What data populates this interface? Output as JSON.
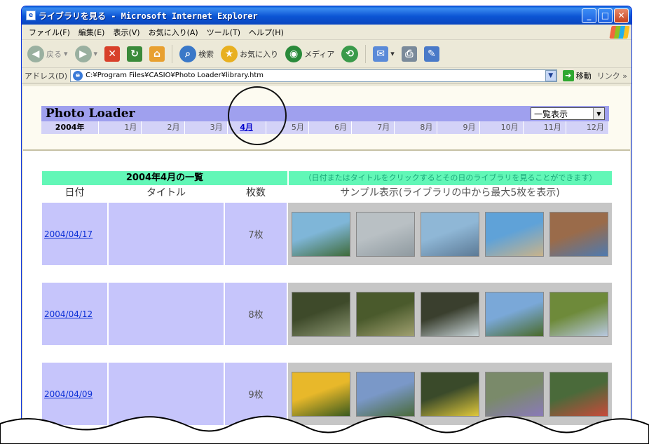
{
  "window": {
    "title": "ライブラリを見る - Microsoft Internet Explorer",
    "app_icon_glyph": "e"
  },
  "menubar": [
    "ファイル(F)",
    "編集(E)",
    "表示(V)",
    "お気に入り(A)",
    "ツール(T)",
    "ヘルプ(H)"
  ],
  "toolbar": {
    "back": "戻る",
    "search": "検索",
    "favorites": "お気に入り",
    "media": "メディア"
  },
  "address": {
    "label": "アドレス(D)",
    "value": "C:¥Program Files¥CASIO¥Photo Loader¥library.htm",
    "go": "移動",
    "links": "リンク »"
  },
  "page": {
    "title": "Photo Loader",
    "view_select": "一覧表示",
    "year": "2004年",
    "months": [
      "1月",
      "2月",
      "3月",
      "4月",
      "5月",
      "6月",
      "7月",
      "8月",
      "9月",
      "10月",
      "11月",
      "12月"
    ],
    "active_month_index": 3,
    "list_title": "2004年4月の一覧",
    "list_hint": "（日付またはタイトルをクリックするとその日のライブラリを見ることができます）",
    "columns": {
      "date": "日付",
      "title": "タイトル",
      "count": "枚数",
      "sample": "サンプル表示(ライブラリの中から最大5枚を表示)"
    },
    "rows": [
      {
        "date": "2004/04/17",
        "count": "7枚",
        "thumbs": [
          [
            "#7fb6d8",
            "#3f6b3a"
          ],
          [
            "#b9c0c4",
            "#8f9aa0"
          ],
          [
            "#8fb7d6",
            "#5c7a96"
          ],
          [
            "#5fa2d8",
            "#c9b38a"
          ],
          [
            "#9a6b4a",
            "#4e7ab0"
          ]
        ]
      },
      {
        "date": "2004/04/12",
        "count": "8枚",
        "thumbs": [
          [
            "#3e4a2a",
            "#8a9470"
          ],
          [
            "#4a5a2c",
            "#a0a070"
          ],
          [
            "#3a3f2e",
            "#c8d4d8"
          ],
          [
            "#7aa8d8",
            "#4a6a2a"
          ],
          [
            "#6e8a3a",
            "#b8c8e0"
          ]
        ]
      },
      {
        "date": "2004/04/09",
        "count": "9枚",
        "thumbs": [
          [
            "#e8b82a",
            "#3a5a1e"
          ],
          [
            "#7a98c8",
            "#4a6a3a"
          ],
          [
            "#3a4a2a",
            "#e0c83a"
          ],
          [
            "#7a8a6a",
            "#8a7ab8"
          ],
          [
            "#4a6a3a",
            "#c84a3a"
          ]
        ]
      }
    ]
  }
}
